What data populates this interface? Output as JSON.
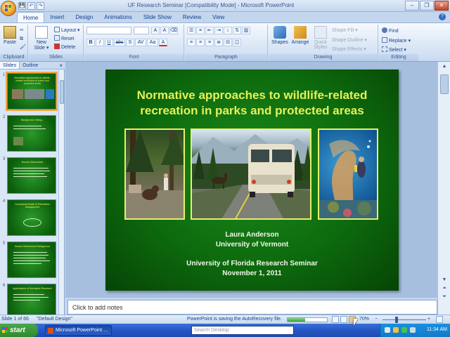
{
  "window": {
    "title": "UF Research Seminar [Compatibility Mode] - Microsoft PowerPoint",
    "controls": {
      "minimize": "–",
      "maximize": "❐",
      "close": "✕"
    }
  },
  "qat": {
    "save": "💾",
    "undo": "↶",
    "redo": "↷"
  },
  "tabs": [
    "Home",
    "Insert",
    "Design",
    "Animations",
    "Slide Show",
    "Review",
    "View"
  ],
  "active_tab": "Home",
  "ribbon": {
    "clipboard": {
      "label": "Clipboard",
      "paste": "Paste"
    },
    "slides": {
      "label": "Slides",
      "new_slide": "New Slide ▾",
      "layout": "Layout ▾",
      "reset": "Reset",
      "delete": "Delete"
    },
    "font": {
      "label": "Font",
      "bold": "B",
      "italic": "I",
      "underline": "U",
      "strike": "abc",
      "shadow": "S",
      "spacing": "AV",
      "case": "Aa",
      "color": "A",
      "grow": "A",
      "shrink": "A",
      "clear": "⌫"
    },
    "paragraph": {
      "label": "Paragraph"
    },
    "drawing": {
      "label": "Drawing",
      "shapes": "Shapes",
      "arrange": "Arrange",
      "quick_styles": "Quick Styles",
      "shape_fill": "Shape Fill ▾",
      "shape_outline": "Shape Outline ▾",
      "shape_effects": "Shape Effects ▾"
    },
    "editing": {
      "label": "Editing",
      "find": "Find",
      "replace": "Replace ▾",
      "select": "Select ▾"
    }
  },
  "panel": {
    "slides_tab": "Slides",
    "outline_tab": "Outline",
    "close": "×"
  },
  "thumbnails": [
    {
      "num": "1",
      "title": "Normative approaches to wildlife-related recreation in parks and protected areas"
    },
    {
      "num": "2",
      "title": "Background: Being..."
    },
    {
      "num": "3",
      "title": "Human Dimensions"
    },
    {
      "num": "4",
      "title": "Conceptual Model of Recreation Management"
    },
    {
      "num": "5",
      "title": "Human Dimensions Background"
    },
    {
      "num": "6",
      "title": "Applications of Normative Research"
    }
  ],
  "slide": {
    "title": "Normative approaches to wildlife-related recreation in parks and protected areas",
    "author": "Laura Anderson",
    "affiliation": "University of Vermont",
    "event": "University of Florida Research Seminar",
    "date": "November 1, 2011"
  },
  "notes": {
    "placeholder": "Click to add notes"
  },
  "status": {
    "slide_counter": "Slide 1 of 66",
    "theme": "\"Default Design\"",
    "autosave": "PowerPoint is saving the AutoRecovery file.",
    "progress": 0.45,
    "zoom": "70%",
    "zoom_minus": "−",
    "zoom_plus": "+"
  },
  "taskbar": {
    "start": "start",
    "app_button": "Microsoft PowerPoint ...",
    "search_placeholder": "Search Desktop",
    "clock": "11:34 AM"
  },
  "colors": {
    "slide_title": "#e6f05a",
    "slide_bg": "#0d6b0d",
    "ribbon": "#dbe7f6",
    "taskbar": "#2457c4"
  }
}
